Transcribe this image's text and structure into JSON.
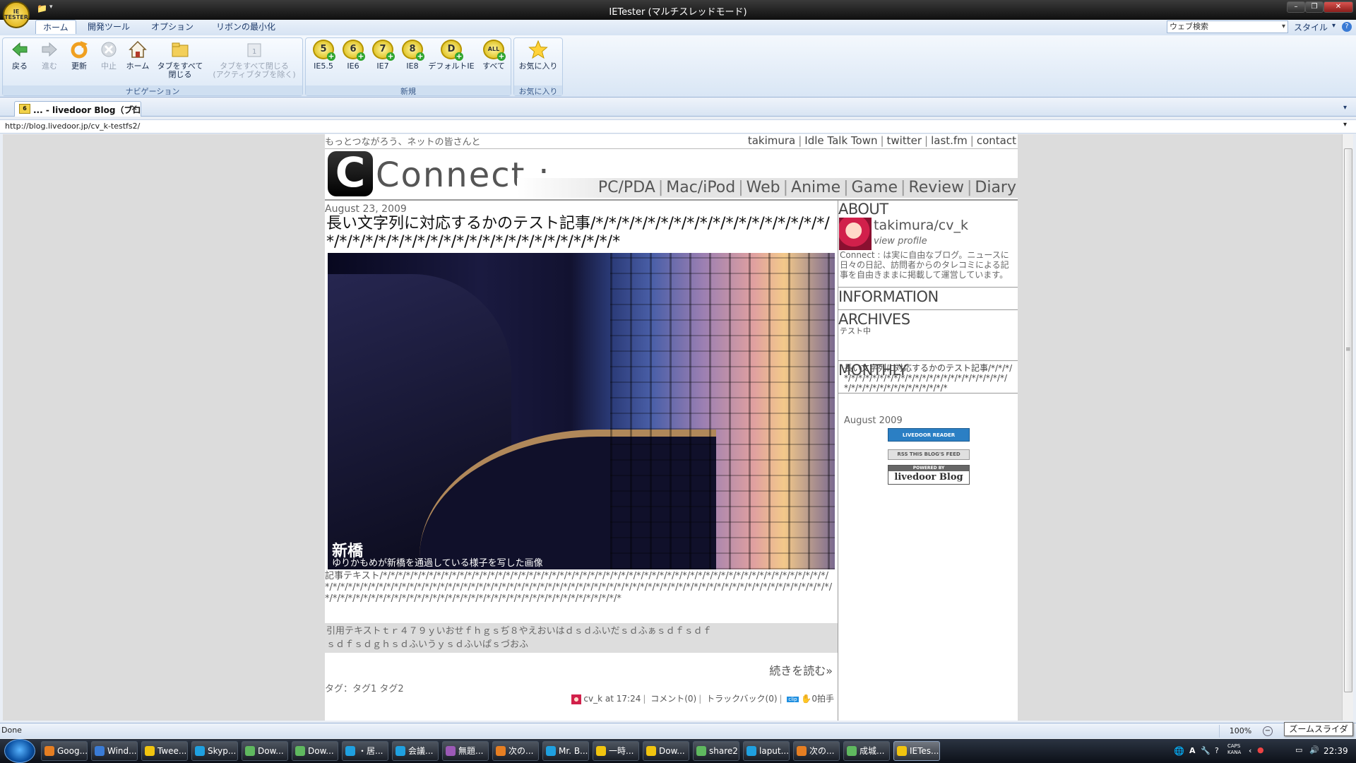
{
  "window": {
    "title": "IETester (マルチスレッドモード)",
    "logo_text": "IE TESTER"
  },
  "ribbon_tabs": [
    "ホーム",
    "開発ツール",
    "オプション",
    "リボンの最小化"
  ],
  "web_search_placeholder": "ウェブ検索",
  "style_label": "スタイル",
  "nav_group": {
    "label": "ナビゲーション",
    "back": "戻る",
    "forward": "進む",
    "refresh": "更新",
    "stop": "中止",
    "home": "ホーム",
    "close_all_l1": "タブをすべて",
    "close_all_l2": "閉じる",
    "close_all_inactive_l1": "タブをすべて閉じる",
    "close_all_inactive_l2": "(アクティブタブを除く)"
  },
  "new_group": {
    "label": "新規",
    "ie55": "IE5.5",
    "ie6": "IE6",
    "ie7": "IE7",
    "ie8": "IE8",
    "default_ie": "デフォルトIE",
    "all": "すべて",
    "ie55_badge": "5",
    "ie6_badge": "6",
    "ie7_badge": "7",
    "ie8_badge": "8",
    "default_badge": "D",
    "all_badge": "ALL"
  },
  "fav_group": {
    "label": "お気に入り",
    "favorites": "お気に入り"
  },
  "tab": {
    "label": "... - livedoor Blog（ブロ...",
    "icon_text": "6"
  },
  "address": "http://blog.livedoor.jp/cv_k-testfs2/",
  "blog": {
    "tagline": "もっとつながろう、ネットの皆さんと",
    "top_links": [
      "takimura",
      "Idle Talk Town",
      "twitter",
      "last.fm",
      "contact"
    ],
    "logo_letter": "C",
    "brand": "Connect :",
    "categories": [
      "PC/PDA",
      "Mac/iPod",
      "Web",
      "Anime",
      "Game",
      "Review",
      "Diary"
    ],
    "post": {
      "date": "August 23, 2009",
      "title": "長い文字列に対応するかのテスト記事/*/*/*/*/*/*/*/*/*/*/*/*/*/*/*/*/*/*/*/*/*/*/*/*/*/*/*/*/*/*/*/*/*/*/*/*/*/*/*/*/*",
      "image_caption_title": "新橋",
      "image_caption_sub": "ゆりかもめが新橋を通過している様子を写した画像",
      "body": "記事テキスト/*/*/*/*/*/*/*/*/*/*/*/*/*/*/*/*/*/*/*/*/*/*/*/*/*/*/*/*/*/*/*/*/*/*/*/*/*/*/*/*/*/*/*/*/*/*/*/*/*/*/*/*/*/*/*/*/*/*/*/*/*/*/*/*/*/*/*/*/*/*/*/*/*/*/*/*/*/*/*/*/*/*/*/*/*/*/*/*/*/*/*/*/*/*/*/*/*/*/*/*/*/*/*/*/*/*/*/*/*/*/*/*/*/*/*/*/*/*/*/*/*/*/*/*/*/*/*/*/*/*/*/*/*/*/*/*/*/*/*/*/*/*/*/*/*/*/*/*/*/*/*/*/*/*/*/*/*/*/*/*/*/*/*",
      "quote_l1": "引用テキストｔｒ４７９ｙいおせｆｈｇｓぢ８やえおいはｄｓｄふいだｓｄふぁｓｄｆｓｄｆ",
      "quote_l2": "ｓｄｆｓｄｇｈｓｄふいうｙｓｄふいぱｓづおふ",
      "read_more": "続きを読む»",
      "tags": "タグ：タグ1 タグ2",
      "author": "cv_k",
      "time": "at 17:24",
      "comments": "コメント(0)",
      "trackbacks": "トラックバック(0)",
      "clip": "clip",
      "claps": "0拍手"
    },
    "sidebar": {
      "about_heading": "ABOUT",
      "profile_name": "takimura/cv_k",
      "view_profile": "view profile",
      "about_text": "Connect : は実に自由なブログ。ニュースに日々の日記、訪問者からのタレコミによる記事を自由きままに掲載して運営しています。",
      "info_heading": "INFORMATION",
      "info_text": "テスト中",
      "archives_heading": "ARCHIVES",
      "archive_item": "長い文字列に対応するかのテスト記事/*/*/*/*/*/*/*/*/*/*/*/*/*/*/*/*/*/*/*/*/*/*/*/*/*/*/*/*/*/*/*/*/*/*/*/*/*/*/*/*/*",
      "monthly_heading": "MONTHLY",
      "monthly_item": "August 2009",
      "badge_reader": "LIVEDOOR READER",
      "badge_rss": "RSS   THIS BLOG'S FEED",
      "badge_powered_top": "POWERED BY",
      "badge_powered": "livedoor Blog"
    }
  },
  "status": {
    "text": "Done",
    "zoom": "100%",
    "zoom_tooltip": "ズームスライダ"
  },
  "taskbar": {
    "items": [
      "Goog...",
      "Wind...",
      "Twee...",
      "Skyp...",
      "Dow...",
      "Dow...",
      "・居...",
      "会議...",
      "無題...",
      "次の...",
      "Mr. B...",
      "一時...",
      "Dow...",
      "share2",
      "laput...",
      "次の...",
      "成城...",
      "IETes..."
    ],
    "icon_colors": [
      "#e67e22",
      "#3a7bd5",
      "#f1c40f",
      "#1fa0e0",
      "#5fb85f",
      "#5fb85f",
      "#1fa0e0",
      "#1fa0e0",
      "#9b59b6",
      "#e67e22",
      "#1fa0e0",
      "#f1c40f",
      "#f1c40f",
      "#5fb85f",
      "#1fa0e0",
      "#e67e22",
      "#5fb85f",
      "#f1c40f"
    ],
    "clock": "22:39",
    "ime": "CAPS KANA"
  }
}
